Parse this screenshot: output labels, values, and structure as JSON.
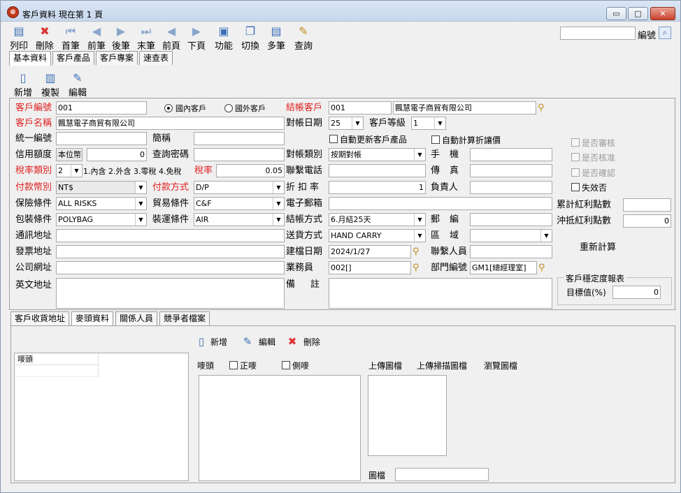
{
  "window": {
    "title": "客戶資料  現在第 1 頁",
    "min_glyph": "▭",
    "max_glyph": "□",
    "close_glyph": "✕"
  },
  "toolbar": [
    {
      "label": "列印",
      "icon": "printer-icon",
      "glyph": "▤"
    },
    {
      "label": "刪除",
      "icon": "delete-icon",
      "glyph": "✖"
    },
    {
      "label": "首筆",
      "icon": "first-record-icon",
      "glyph": "⏮"
    },
    {
      "label": "前筆",
      "icon": "prev-record-icon",
      "glyph": "◀"
    },
    {
      "label": "後筆",
      "icon": "next-record-icon",
      "glyph": "▶"
    },
    {
      "label": "末筆",
      "icon": "last-record-icon",
      "glyph": "⏭"
    },
    {
      "label": "前頁",
      "icon": "prev-page-icon",
      "glyph": "◀"
    },
    {
      "label": "下頁",
      "icon": "next-page-icon",
      "glyph": "▶"
    },
    {
      "label": "功能",
      "icon": "function-icon",
      "glyph": "▣"
    },
    {
      "label": "切換",
      "icon": "switch-icon",
      "glyph": "❐"
    },
    {
      "label": "多筆",
      "icon": "multi-record-icon",
      "glyph": "▤"
    },
    {
      "label": "查詢",
      "icon": "query-icon",
      "glyph": "✎"
    }
  ],
  "search": {
    "label": "編號",
    "value": "",
    "glyph": "⌕"
  },
  "main_tabs": [
    "基本資料",
    "客戶產品",
    "客戶專案",
    "速查表"
  ],
  "sub_toolbar": [
    {
      "label": "新增",
      "glyph": "▯"
    },
    {
      "label": "複製",
      "glyph": "▥"
    },
    {
      "label": "編輯",
      "glyph": "✎"
    }
  ],
  "form": {
    "customer_no": {
      "label": "客戶編號",
      "value": "001"
    },
    "domestic": "國內客戶",
    "foreign": "國外客戶",
    "billing_customer": {
      "label": "結帳客戶",
      "code": "001",
      "name": "飄慧電子商貿有限公司"
    },
    "customer_name": {
      "label": "客戶名稱",
      "value": "飄慧電子商貿有限公司"
    },
    "statement_day": {
      "label": "對帳日期",
      "value": "25"
    },
    "customer_level": {
      "label": "客戶等級",
      "value": "1"
    },
    "tax_id": {
      "label": "統一編號",
      "value": ""
    },
    "short_name": {
      "label": "簡稱",
      "value": ""
    },
    "auto_update": "自動更新客戶產品",
    "auto_discount": "自動計算折讓價",
    "credit_limit": {
      "label": "信用額度",
      "unit": "本位幣",
      "value": "0"
    },
    "query_password": {
      "label": "查詢密碼",
      "value": ""
    },
    "statement_type": {
      "label": "對帳類別",
      "value": "按期對帳"
    },
    "mobile": {
      "label": "手機",
      "value": ""
    },
    "tax_type": {
      "label": "稅率類別",
      "value": "2",
      "hint": "1.內含 2.外含 3.零稅 4.免稅"
    },
    "tax_rate": {
      "label": "稅率",
      "value": "0.05"
    },
    "contact_phone": {
      "label": "聯繫電話",
      "value": ""
    },
    "fax": {
      "label": "傳真",
      "value": ""
    },
    "currency": {
      "label": "付款幣別",
      "value": "NT$"
    },
    "payment_method": {
      "label": "付款方式",
      "value": "D/P"
    },
    "discount_rate": {
      "label": "折扣率",
      "value": "1"
    },
    "person_in_charge": {
      "label": "負責人",
      "value": ""
    },
    "insurance": {
      "label": "保險條件",
      "value": "ALL RISKS"
    },
    "trade_terms": {
      "label": "貿易條件",
      "value": "C&F"
    },
    "email": {
      "label": "電子郵箱",
      "value": ""
    },
    "packing": {
      "label": "包裝條件",
      "value": "POLYBAG"
    },
    "shipping": {
      "label": "裝運條件",
      "value": "AIR"
    },
    "settlement": {
      "label": "結帳方式",
      "value": "6.月結25天"
    },
    "postal_code": {
      "label": "郵編",
      "value": ""
    },
    "mailing_address": {
      "label": "通訊地址",
      "value": ""
    },
    "delivery_method": {
      "label": "送貨方式",
      "value": "HAND CARRY"
    },
    "region": {
      "label": "區域",
      "value": ""
    },
    "invoice_address": {
      "label": "發票地址",
      "value": ""
    },
    "created_date": {
      "label": "建檔日期",
      "value": "2024/1/27"
    },
    "contact_person": {
      "label": "聯繫人員",
      "value": ""
    },
    "website": {
      "label": "公司網址",
      "value": ""
    },
    "salesperson": {
      "label": "業務員",
      "value": "002[]"
    },
    "department": {
      "label": "部門編號",
      "value": "GM1[總經理室]"
    },
    "english_address": {
      "label": "英文地址",
      "value": ""
    },
    "remarks": {
      "label": "備註",
      "value": ""
    },
    "is_reviewed": "是否審核",
    "is_approved": "是否核准",
    "is_confirmed": "是否確認",
    "is_invalid": "失效否",
    "accum_points": {
      "label": "累計紅利點數",
      "value": ""
    },
    "offset_points": {
      "label": "沖抵紅利點數",
      "value": "0"
    },
    "recalc": "重新計算",
    "stability_report": {
      "title": "客戶穩定度報表",
      "label": "目標值(%)",
      "value": "0"
    }
  },
  "lower_tabs": [
    "客戶收貨地址",
    "麥頭資料",
    "關係人員",
    "競爭者檔案"
  ],
  "lower": {
    "add": "新增",
    "edit": "編輯",
    "delete": "刪除",
    "list_header": "嘜頭",
    "mark_label": "嘜頭",
    "front_mark": "正嘜",
    "side_mark": "側嘜",
    "upload_image": "上傳圖檔",
    "upload_scan": "上傳掃描圖檔",
    "browse_image": "瀏覽圖檔",
    "image_file": "圖檔"
  }
}
